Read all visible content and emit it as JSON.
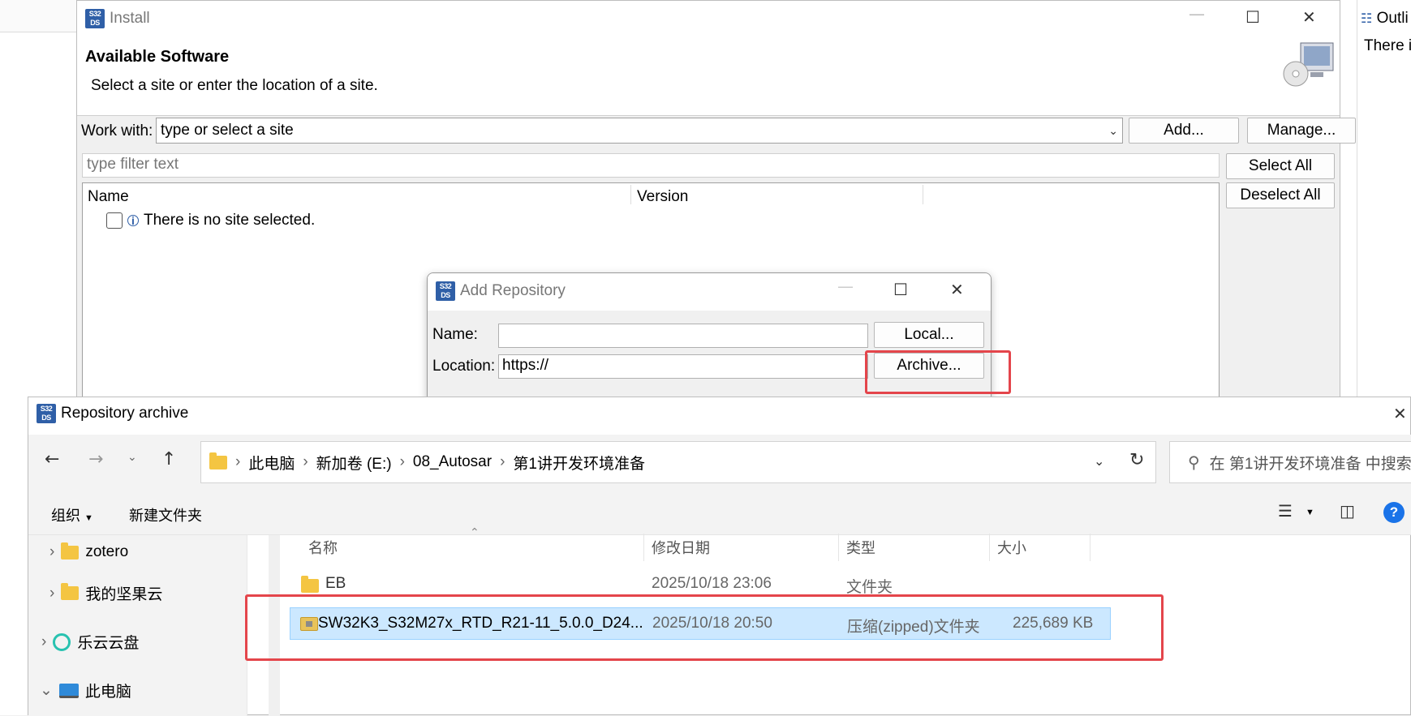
{
  "ide": {
    "outline_tab": "Outli",
    "outline_text": "There i"
  },
  "install": {
    "title": "Install",
    "heading": "Available Software",
    "subheading": "Select a site or enter the location of a site.",
    "work_with_label": "Work with:",
    "work_with_value": "type or select a site",
    "add_button": "Add...",
    "manage_button": "Manage...",
    "filter_placeholder": "type filter text",
    "select_all_button": "Select All",
    "deselect_all_button": "Deselect All",
    "columns": [
      "Name",
      "Version"
    ],
    "empty_message": "There is no site selected."
  },
  "add_repository": {
    "title": "Add Repository",
    "name_label": "Name:",
    "name_value": "",
    "location_label": "Location:",
    "location_value": "https://",
    "local_button": "Local...",
    "archive_button": "Archive..."
  },
  "archive_dialog": {
    "title": "Repository archive",
    "breadcrumb": [
      "此电脑",
      "新加卷 (E:)",
      "08_Autosar",
      "第1讲开发环境准备"
    ],
    "search_placeholder": "在 第1讲开发环境准备 中搜索",
    "toolbar": {
      "organize": "组织",
      "new_folder": "新建文件夹"
    },
    "nav_items": [
      {
        "label": "zotero"
      },
      {
        "label": "我的坚果云"
      },
      {
        "label": "乐云云盘"
      },
      {
        "label": "此电脑"
      }
    ],
    "columns": [
      "名称",
      "修改日期",
      "类型",
      "大小"
    ],
    "files": [
      {
        "name": "EB",
        "date": "2025/10/18 23:06",
        "type": "文件夹",
        "size": ""
      },
      {
        "name": "SW32K3_S32M27x_RTD_R21-11_5.0.0_D24...",
        "date": "2025/10/18 20:50",
        "type": "压缩(zipped)文件夹",
        "size": "225,689 KB"
      }
    ]
  },
  "colors": {
    "highlight": "#e4454b",
    "selection": "#cce8ff"
  }
}
